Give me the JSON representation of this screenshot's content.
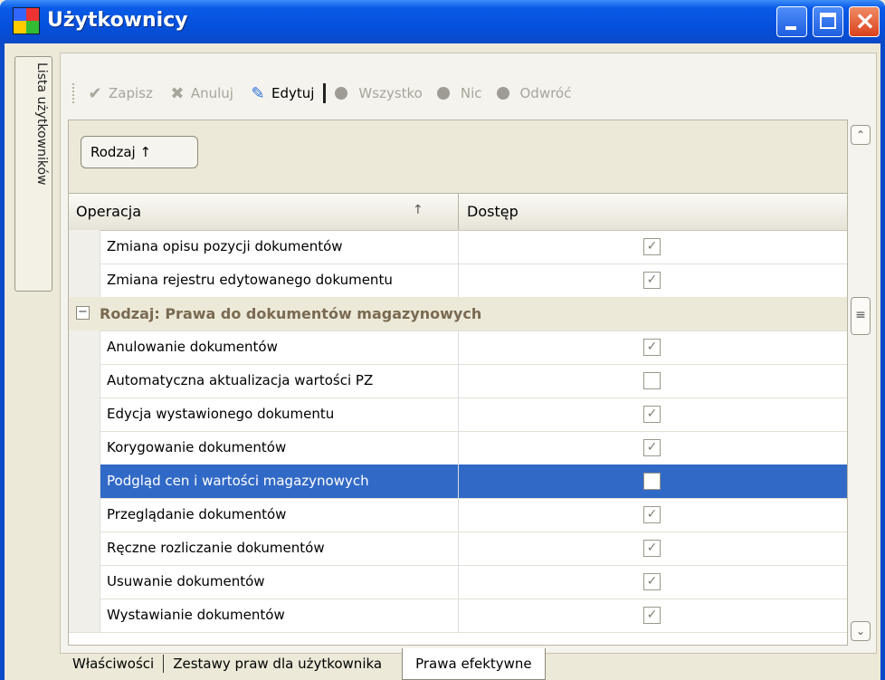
{
  "window": {
    "title": "Użytkownicy"
  },
  "side_tab": {
    "label": "Lista użytkowników"
  },
  "toolbar": {
    "save": "Zapisz",
    "cancel": "Anuluj",
    "edit": "Edytuj",
    "all": "Wszystko",
    "none": "Nic",
    "invert": "Odwróć"
  },
  "group_by": {
    "label": "Rodzaj ↑"
  },
  "columns": {
    "operation": "Operacja",
    "sort_arrow": "↑",
    "access": "Dostęp"
  },
  "rows_top": [
    {
      "name": "Zmiana opisu pozycji dokumentów",
      "checked": true
    },
    {
      "name": "Zmiana rejestru edytowanego dokumentu",
      "checked": true
    }
  ],
  "group": {
    "title": "Rodzaj: Prawa do dokumentów magazynowych",
    "toggle": "−"
  },
  "rows_group": [
    {
      "name": "Anulowanie dokumentów",
      "checked": true
    },
    {
      "name": "Automatyczna aktualizacja wartości PZ",
      "checked": false
    },
    {
      "name": "Edycja wystawionego dokumentu",
      "checked": true
    },
    {
      "name": "Korygowanie dokumentów",
      "checked": true
    },
    {
      "name": "Podgląd cen i wartości magazynowych",
      "checked": false,
      "selected": true
    },
    {
      "name": "Przeglądanie dokumentów",
      "checked": true
    },
    {
      "name": "Ręczne rozliczanie dokumentów",
      "checked": true
    },
    {
      "name": "Usuwanie dokumentów",
      "checked": true
    },
    {
      "name": "Wystawianie dokumentów",
      "checked": true
    }
  ],
  "bottom_tabs": {
    "properties": "Właściwości",
    "rights_sets": "Zestawy praw dla użytkownika",
    "effective": "Prawa efektywne"
  }
}
